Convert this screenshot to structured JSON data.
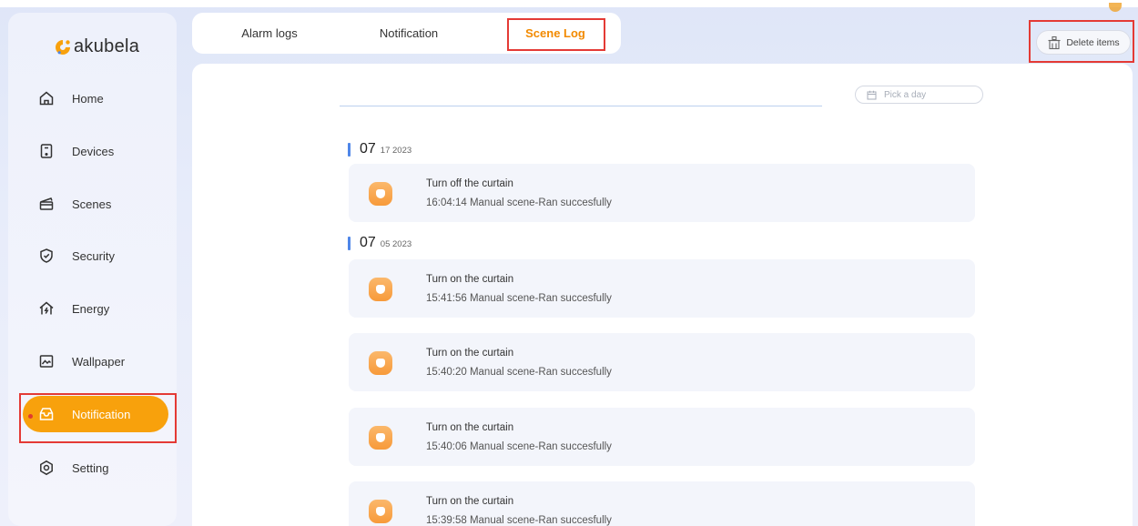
{
  "app": {
    "logo_text": "akubela",
    "brand_color": "#f8a10c",
    "highlight_color": "#e43a35"
  },
  "sidebar": {
    "items": [
      {
        "label": "Home",
        "icon": "home-icon"
      },
      {
        "label": "Devices",
        "icon": "device-icon"
      },
      {
        "label": "Scenes",
        "icon": "scenes-icon"
      },
      {
        "label": "Security",
        "icon": "shield-icon"
      },
      {
        "label": "Energy",
        "icon": "energy-icon"
      },
      {
        "label": "Wallpaper",
        "icon": "wallpaper-icon"
      },
      {
        "label": "Notification",
        "icon": "notification-icon",
        "active": true
      },
      {
        "label": "Setting",
        "icon": "setting-icon"
      }
    ]
  },
  "tabs": [
    {
      "label": "Alarm logs"
    },
    {
      "label": "Notification"
    },
    {
      "label": "Scene Log",
      "active": true
    }
  ],
  "toolbar": {
    "delete_label": "Delete items",
    "delete_icon": "delete-icon"
  },
  "filter": {
    "pick_day_placeholder": "Pick a day",
    "icon": "calendar-icon"
  },
  "groups": [
    {
      "day": "07",
      "rest": "17 2023",
      "entries": [
        {
          "title": "Turn off the curtain",
          "detail": "16:04:14 Manual scene-Ran succesfully"
        }
      ]
    },
    {
      "day": "07",
      "rest": "05 2023",
      "entries": [
        {
          "title": "Turn on the curtain",
          "detail": "15:41:56 Manual scene-Ran succesfully"
        },
        {
          "title": "Turn on the curtain",
          "detail": "15:40:20 Manual scene-Ran succesfully"
        },
        {
          "title": "Turn on the curtain",
          "detail": "15:40:06 Manual scene-Ran succesfully"
        },
        {
          "title": "Turn on the curtain",
          "detail": "15:39:58 Manual scene-Ran succesfully"
        }
      ]
    }
  ]
}
